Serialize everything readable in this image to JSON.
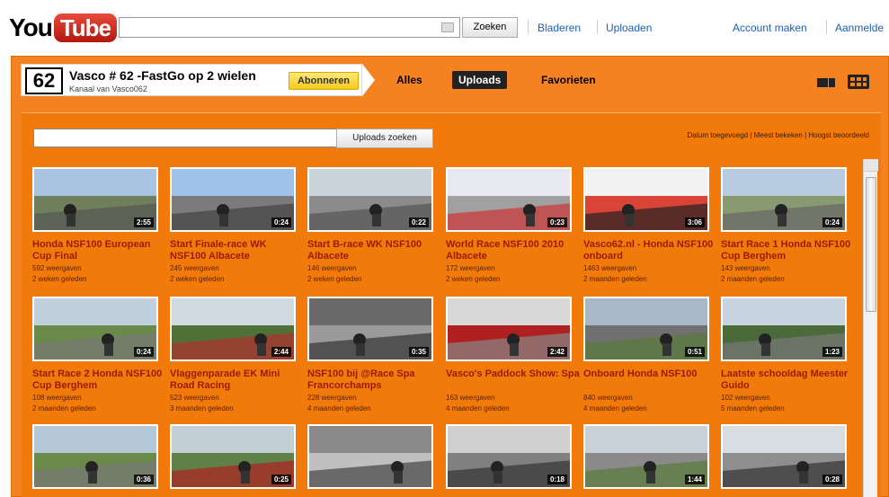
{
  "header": {
    "logo_you": "You",
    "logo_tube": "Tube",
    "search_button": "Zoeken",
    "links": [
      "Bladeren",
      "Uploaden"
    ],
    "right_links": [
      "Account maken",
      "Aanmelde"
    ]
  },
  "channel": {
    "number": "62",
    "title": "Vasco # 62 -FastGo op 2 wielen",
    "subtitle": "Kanaal van Vasco062",
    "subscribe_label": "Abonneren",
    "tabs": [
      "Alles",
      "Uploads",
      "Favorieten"
    ],
    "active_tab": "Uploads",
    "search_button": "Uploads zoeken",
    "sort_links": "Datum toegevoegd | Meest bekeken | Hoogst beoordeeld"
  },
  "videos": [
    {
      "title": "Honda NSF100 European Cup Final",
      "views": "592 weergaven",
      "age": "2 weken geleden",
      "duration": "2:55"
    },
    {
      "title": "Start Finale-race WK NSF100 Albacete",
      "views": "245 weergaven",
      "age": "2 weken geleden",
      "duration": "0:24"
    },
    {
      "title": "Start B-race WK NSF100 Albacete",
      "views": "146 weergaven",
      "age": "2 weken geleden",
      "duration": "0:22"
    },
    {
      "title": "World Race NSF100 2010 Albacete",
      "views": "172 weergaven",
      "age": "2 weken geleden",
      "duration": "0:23"
    },
    {
      "title": "Vasco62.nl - Honda NSF100 onboard",
      "views": "1463 weergaven",
      "age": "2 maanden geleden",
      "duration": "3:06"
    },
    {
      "title": "Start Race 1 Honda NSF100 Cup Berghem",
      "views": "143 weergaven",
      "age": "2 maanden geleden",
      "duration": "0:24"
    },
    {
      "title": "Start Race 2 Honda NSF100 Cup Berghem",
      "views": "108 weergaven",
      "age": "2 maanden geleden",
      "duration": "0:24"
    },
    {
      "title": "Vlaggenparade EK Mini Road Racing",
      "views": "523 weergaven",
      "age": "3 maanden geleden",
      "duration": "2:44"
    },
    {
      "title": "NSF100 bij @Race Spa Francorchamps",
      "views": "228 weergaven",
      "age": "4 maanden geleden",
      "duration": "0:35"
    },
    {
      "title": "Vasco's Paddock Show: Spa",
      "views": "163 weergaven",
      "age": "4 maanden geleden",
      "duration": "2:42"
    },
    {
      "title": "Onboard Honda NSF100",
      "views": "840 weergaven",
      "age": "4 maanden geleden",
      "duration": "0:51"
    },
    {
      "title": "Laatste schooldag Meester Guido",
      "views": "102 weergaven",
      "age": "5 maanden geleden",
      "duration": "1:23"
    },
    {
      "title": "",
      "views": "",
      "age": "",
      "duration": "0:36"
    },
    {
      "title": "",
      "views": "",
      "age": "",
      "duration": "0:25"
    },
    {
      "title": "",
      "views": "",
      "age": "",
      "duration": ""
    },
    {
      "title": "",
      "views": "",
      "age": "",
      "duration": "0:18"
    },
    {
      "title": "",
      "views": "",
      "age": "",
      "duration": "1:44"
    },
    {
      "title": "",
      "views": "",
      "age": "",
      "duration": "0:28"
    }
  ],
  "colors": {
    "channel_bg": "#f58220",
    "title_link": "#9b1b00",
    "top_link": "#1a5fb4",
    "subscribe": "#f6c91c"
  }
}
